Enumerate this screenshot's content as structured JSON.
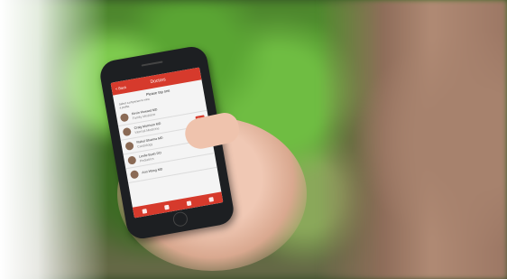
{
  "screen": {
    "header": {
      "back": "< Back",
      "title": "Doctors"
    },
    "subhead": "Please tap one",
    "intro": [
      "Select a physician to view",
      "a profile."
    ],
    "doctors": [
      {
        "name": "Kevin Howard MD",
        "sub": "Family Medicine",
        "tag": ""
      },
      {
        "name": "Craig Morrison MD",
        "sub": "Internal Medicine",
        "tag": "New"
      },
      {
        "name": "Rahul Sharma MD",
        "sub": "Cardiology",
        "tag": ""
      },
      {
        "name": "Leslie Bush DO",
        "sub": "Pediatrics",
        "tag": ""
      },
      {
        "name": "Ann Wong MD",
        "sub": "",
        "tag": ""
      }
    ]
  },
  "colors": {
    "accent": "#d63a2c",
    "foliage": "#5aa533"
  }
}
